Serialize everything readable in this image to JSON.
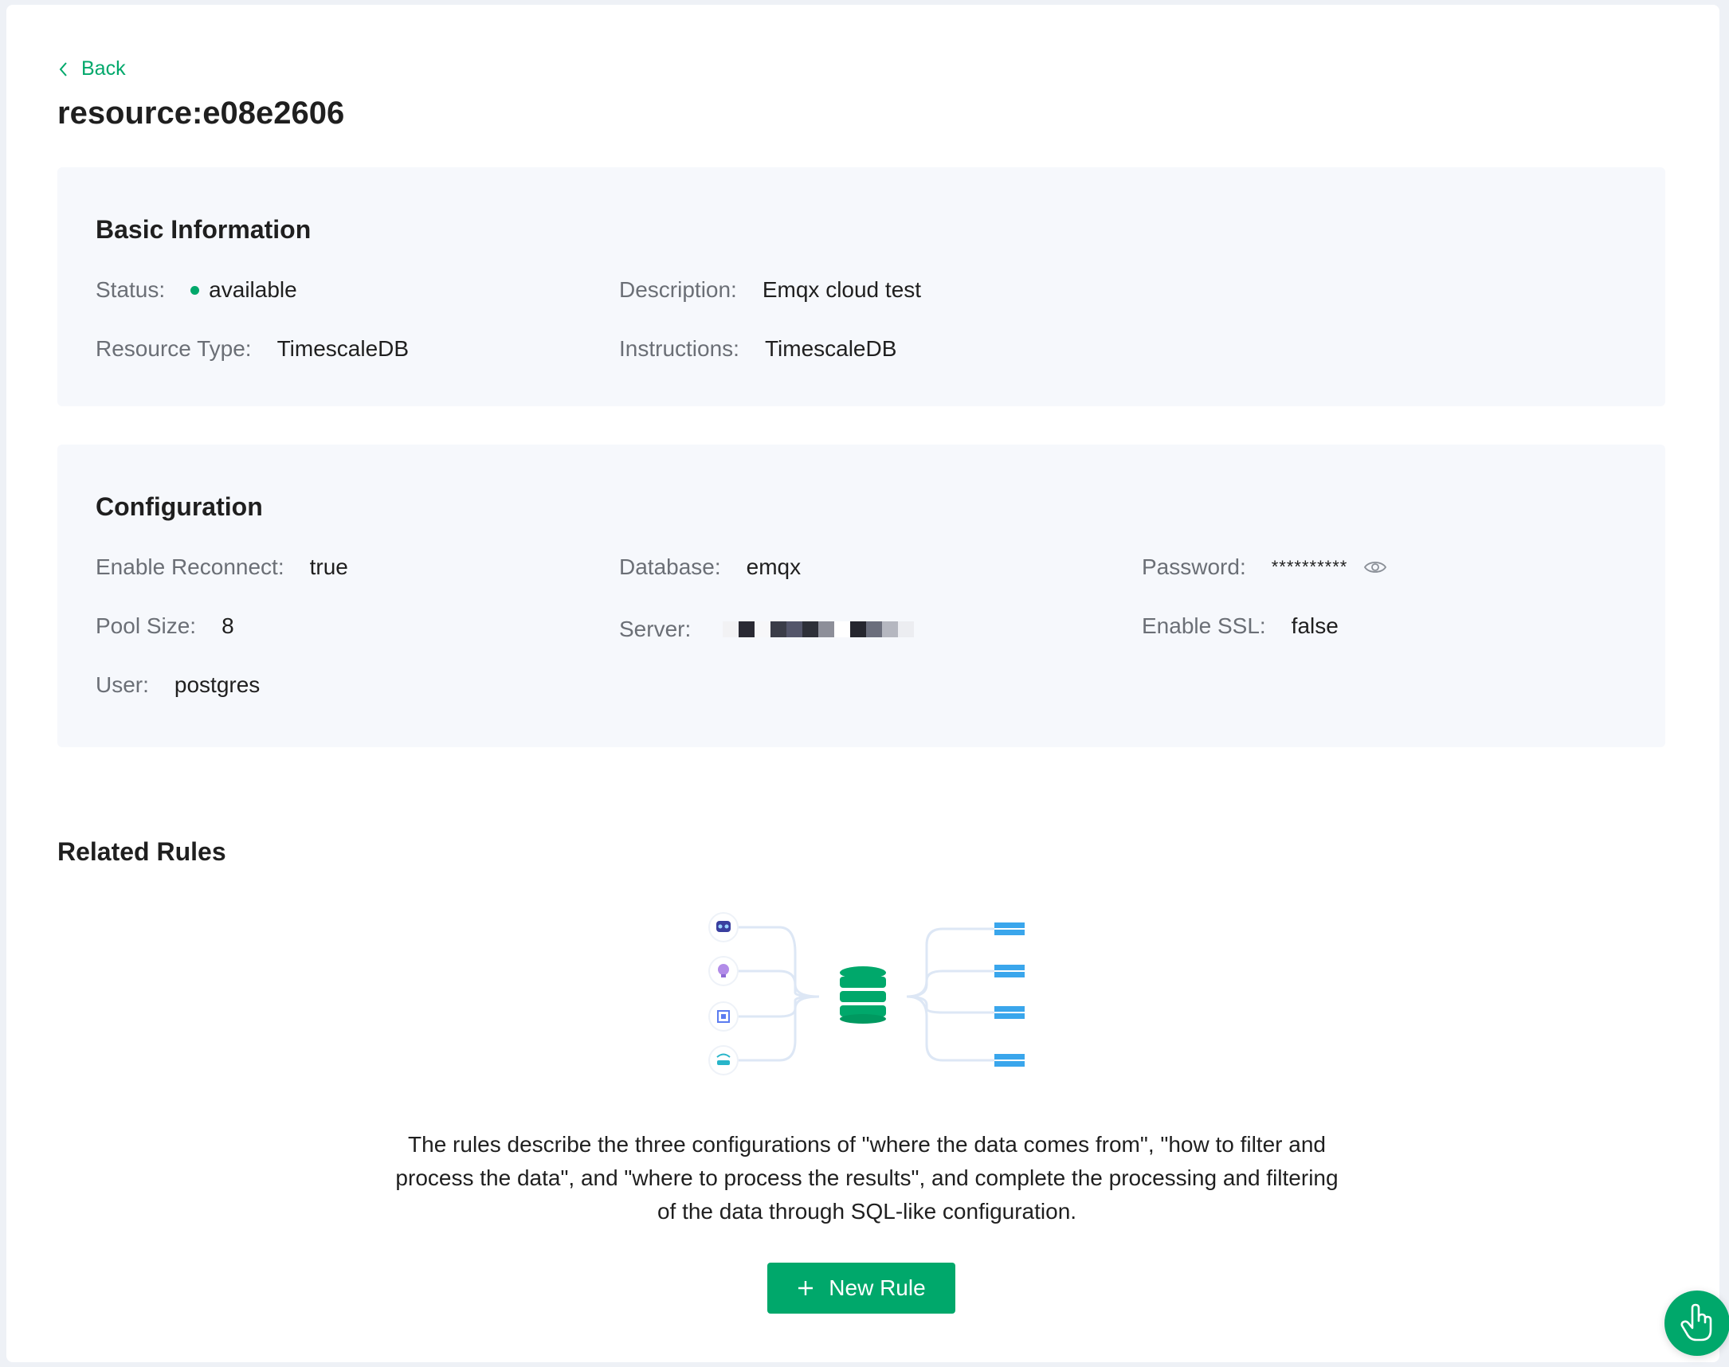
{
  "nav": {
    "back_label": "Back"
  },
  "page_title": "resource:e08e2606",
  "basic": {
    "heading": "Basic Information",
    "status_label": "Status:",
    "status_value": "available",
    "description_label": "Description:",
    "description_value": "Emqx cloud test",
    "resource_type_label": "Resource Type:",
    "resource_type_value": "TimescaleDB",
    "instructions_label": "Instructions:",
    "instructions_value": "TimescaleDB"
  },
  "config": {
    "heading": "Configuration",
    "enable_reconnect_label": "Enable Reconnect:",
    "enable_reconnect_value": "true",
    "database_label": "Database:",
    "database_value": "emqx",
    "password_label": "Password:",
    "password_value": "**********",
    "pool_size_label": "Pool Size:",
    "pool_size_value": "8",
    "server_label": "Server:",
    "enable_ssl_label": "Enable SSL:",
    "enable_ssl_value": "false",
    "user_label": "User:",
    "user_value": "postgres"
  },
  "related": {
    "heading": "Related Rules",
    "description": "The rules describe the three configurations of \"where the data comes from\", \"how to filter and process the data\", and \"where to process the results\", and complete the processing and filtering of the data through SQL-like configuration.",
    "new_rule_label": "New Rule"
  },
  "colors": {
    "accent": "#00a86b",
    "card_bg": "#f6f8fc",
    "label": "#6b6f76",
    "server_blue": "#3aa6ec"
  },
  "icons": [
    "chevron-left-icon",
    "eye-icon",
    "database-icon",
    "robot-icon",
    "bulb-icon",
    "chip-icon",
    "router-icon",
    "server-icon",
    "plus-icon",
    "pointer-hand-icon"
  ]
}
